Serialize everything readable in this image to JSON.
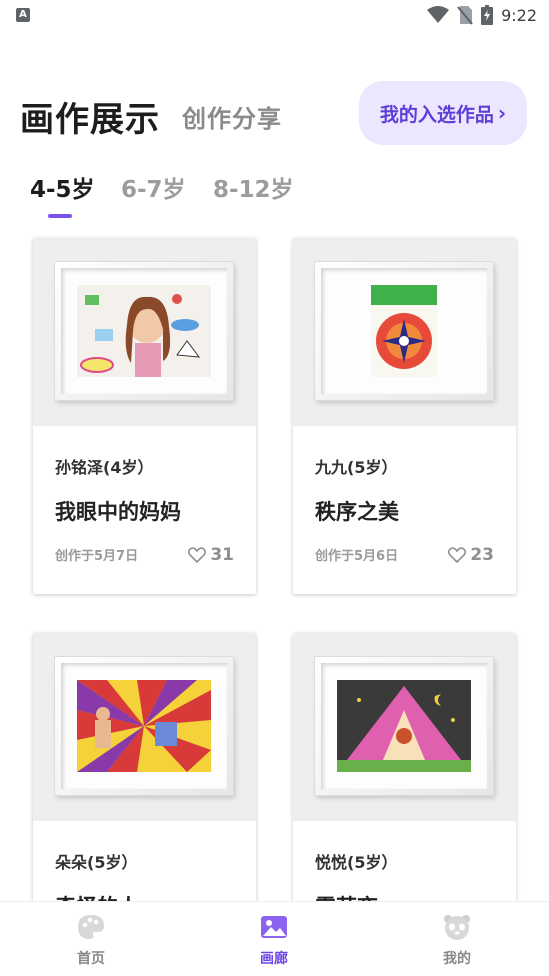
{
  "status_bar": {
    "time": "9:22",
    "left_icon": "A"
  },
  "header": {
    "title": "画作展示",
    "subtitle": "创作分享",
    "pick_button": {
      "label": "我的入选作品",
      "chevron": "›"
    }
  },
  "tabs": [
    {
      "label": "4-5岁",
      "active": true
    },
    {
      "label": "6-7岁",
      "active": false
    },
    {
      "label": "8-12岁",
      "active": false
    }
  ],
  "cards": [
    {
      "author": "孙铭泽(4岁）",
      "title": "我眼中的妈妈",
      "created": "创作于5月7日",
      "likes": "31"
    },
    {
      "author": "九九(5岁）",
      "title": "秩序之美",
      "created": "创作于5月6日",
      "likes": "23"
    },
    {
      "author": "朵朵(5岁）",
      "title": "奇怪的人",
      "created": "",
      "likes": ""
    },
    {
      "author": "悦悦(5岁）",
      "title": "露营夜",
      "created": "",
      "likes": ""
    }
  ],
  "bottom_nav": [
    {
      "label": "首页",
      "icon": "palette-icon",
      "active": false
    },
    {
      "label": "画廊",
      "icon": "gallery-icon",
      "active": true
    },
    {
      "label": "我的",
      "icon": "panda-icon",
      "active": false
    }
  ],
  "colors": {
    "accent": "#7a52f0",
    "accent_text": "#5b3fd6",
    "pick_bg": "#ece7ff"
  }
}
